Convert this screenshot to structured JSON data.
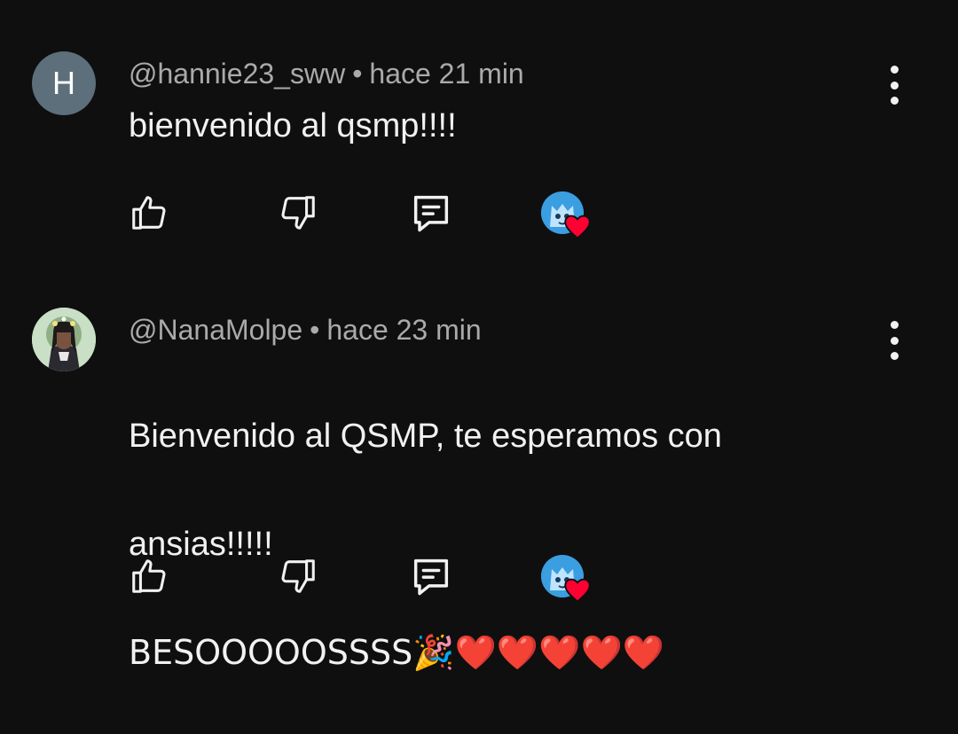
{
  "comments": [
    {
      "avatar_letter": "H",
      "author": "@hannie23_sww",
      "separator": "•",
      "time": "hace 21 min",
      "text": "bienvenido al qsmp!!!!"
    },
    {
      "author": "@NanaMolpe",
      "separator": "•",
      "time": "hace 23 min",
      "text_line1": "Bienvenido al QSMP, te esperamos con",
      "text_line2": "ansias!!!!!",
      "text_line3": "BESOOOOOSSSS🎉❤️❤️❤️❤️❤️"
    }
  ],
  "icons": {
    "like": "thumbs-up-icon",
    "dislike": "thumbs-down-icon",
    "reply": "reply-comment-icon",
    "creator_heart": "creator-heart-icon",
    "more": "more-vertical-icon"
  },
  "colors": {
    "background": "#0f0f0f",
    "text": "#f1f1f1",
    "meta": "#aaaaaa",
    "heart": "#ff0033",
    "avatar_h": "#5c6f7b"
  }
}
